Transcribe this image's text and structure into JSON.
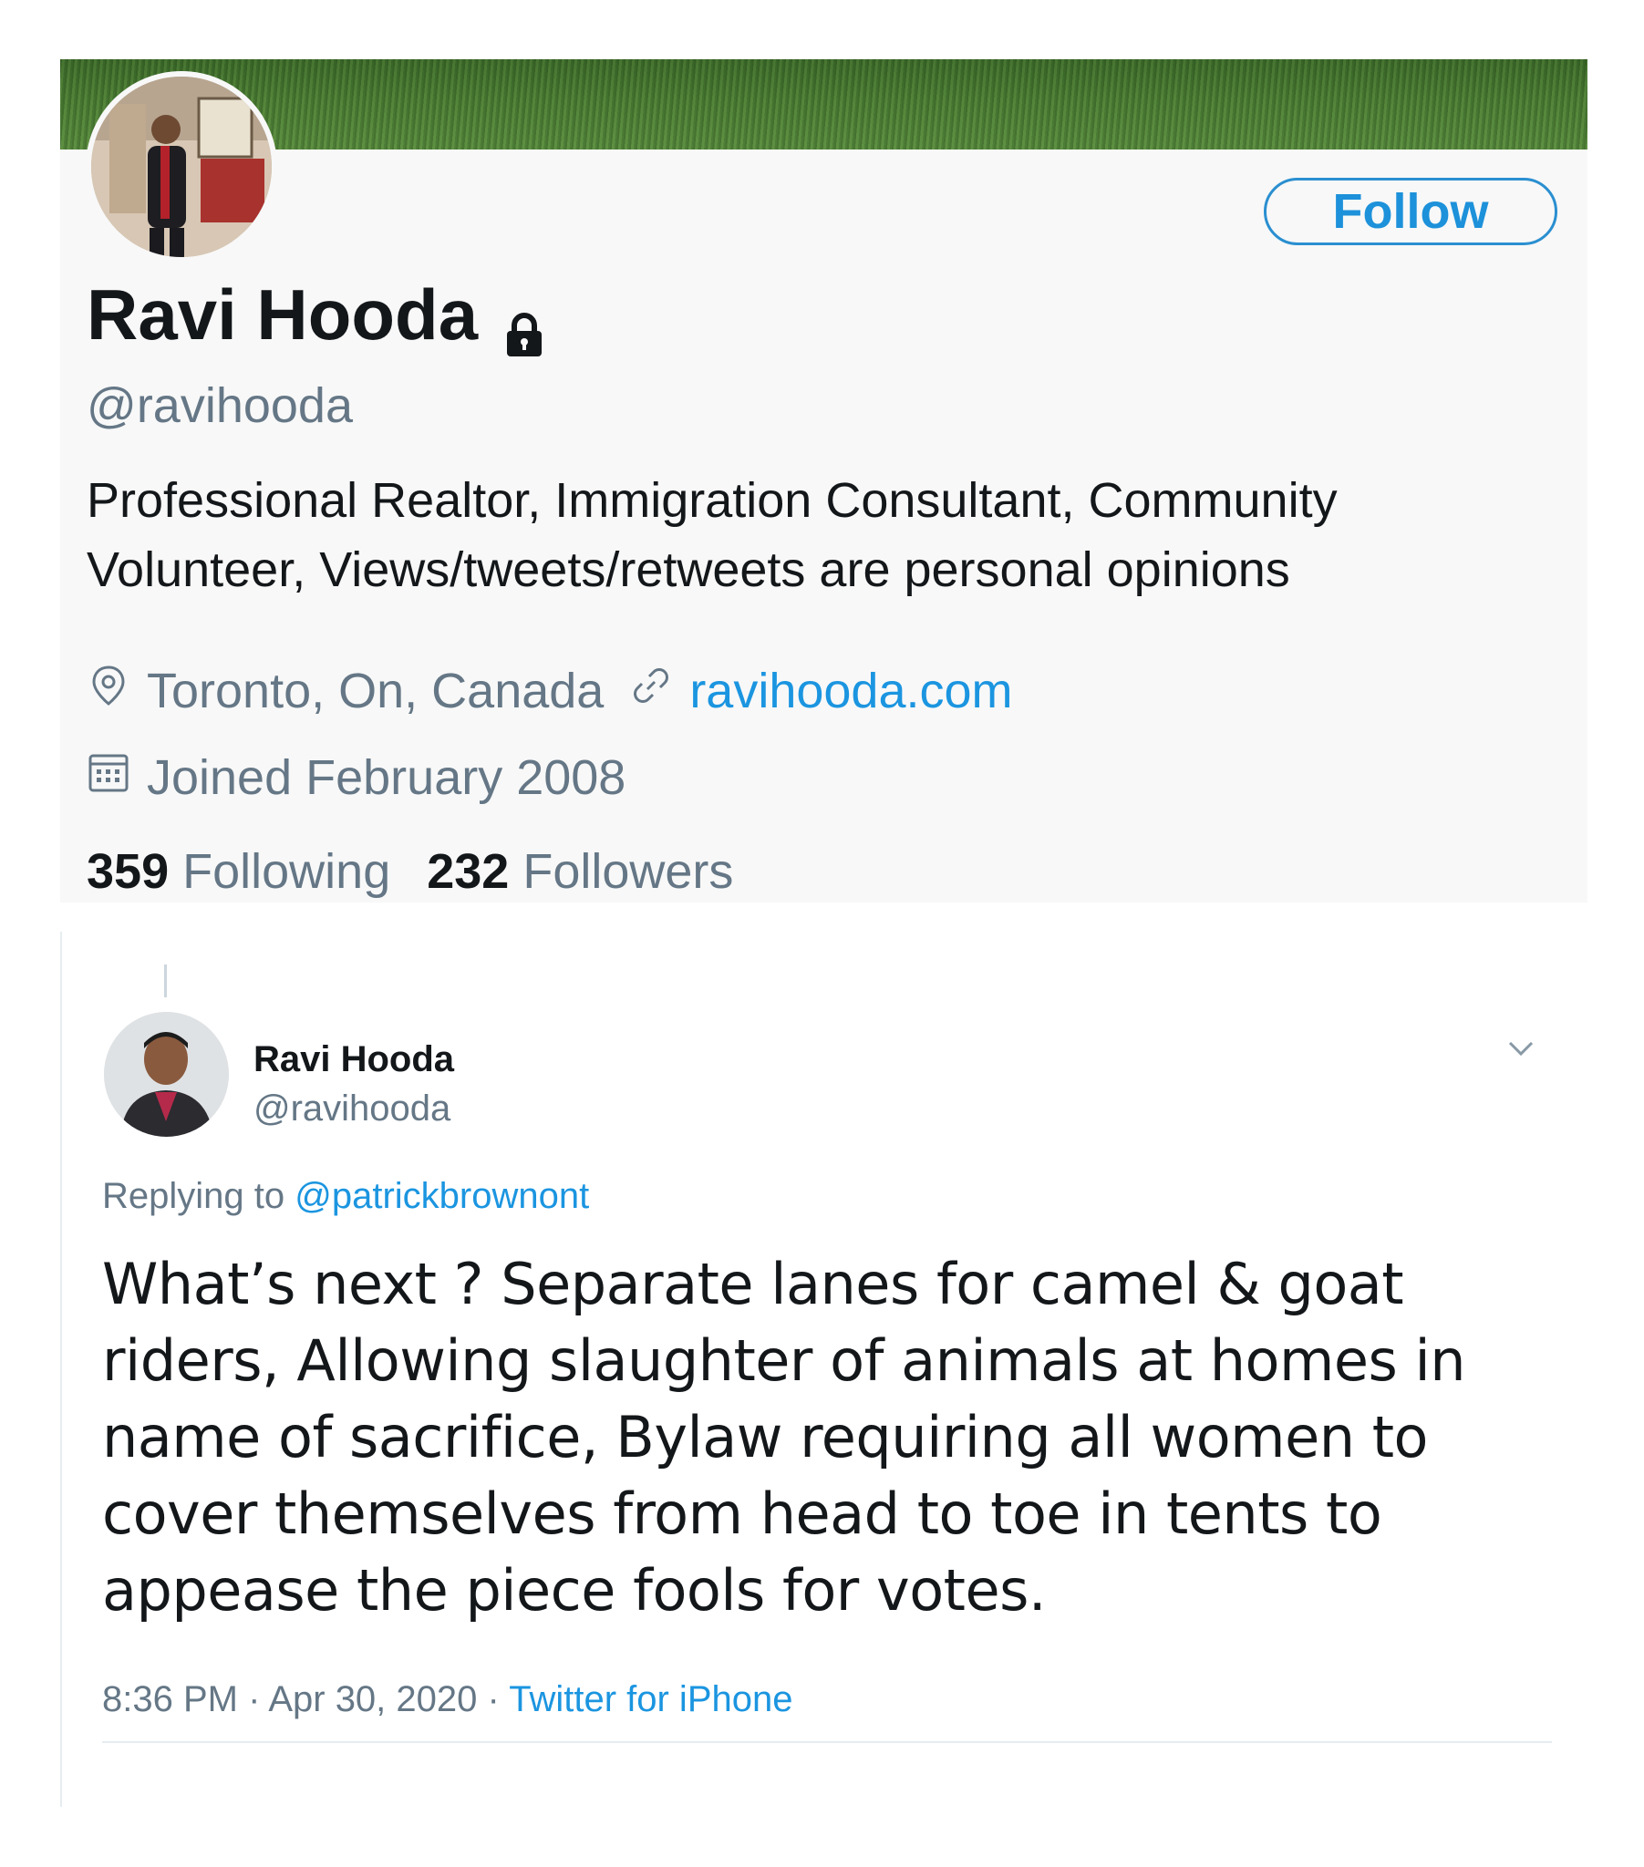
{
  "profile": {
    "follow_label": "Follow",
    "name": "Ravi Hooda",
    "handle": "@ravihooda",
    "bio": "Professional Realtor, Immigration Consultant, Community Volunteer, Views/tweets/retweets are personal opinions",
    "location": "Toronto, On, Canada",
    "website": "ravihooda.com",
    "joined": "Joined February 2008",
    "following_count": "359",
    "following_label": "Following",
    "followers_count": "232",
    "followers_label": "Followers",
    "icons": {
      "lock": "lock-icon",
      "location": "location-pin-icon",
      "link": "link-icon",
      "calendar": "calendar-icon"
    }
  },
  "tweet": {
    "author_name": "Ravi Hooda",
    "author_handle": "@ravihooda",
    "replying_prefix": "Replying to",
    "replying_to": "@patrickbrownont",
    "text": "What’s next ? Separate lanes for camel & goat riders, Allowing slaughter of animals at homes in name of sacrifice, Bylaw requiring all women to cover themselves from head to toe in tents to appease the piece fools for votes.",
    "time": "8:36 PM",
    "date": "Apr 30, 2020",
    "source": "Twitter for iPhone",
    "separator": "·",
    "icons": {
      "menu": "chevron-down-icon"
    }
  },
  "colors": {
    "accent": "#1b95e0",
    "secondary_text": "#657786",
    "primary_text": "#14171a",
    "banner": "#4d7e36"
  }
}
